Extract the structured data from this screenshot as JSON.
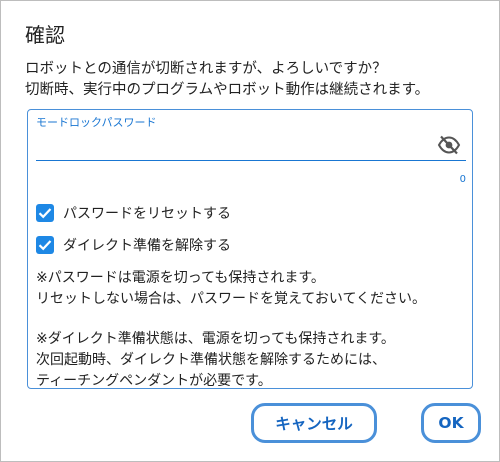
{
  "dialog": {
    "title": "確認",
    "message_line1": "ロボットとの通信が切断されますが、よろしいですか？",
    "message_line2": "切断時、実行中のプログラムやロボット動作は継続されます。"
  },
  "password_field": {
    "label": "モードロックパスワード",
    "value": "",
    "counter": "0",
    "toggle_icon": "eye-off-icon"
  },
  "checkboxes": [
    {
      "label": "パスワードをリセットする",
      "checked": true
    },
    {
      "label": "ダイレクト準備を解除する",
      "checked": true
    }
  ],
  "notes": {
    "line1": "※パスワードは電源を切っても保持されます。",
    "line2": "リセットしない場合は、パスワードを覚えておいてください。",
    "line3": "※ダイレクト準備状態は、電源を切っても保持されます。",
    "line4": "次回起動時、ダイレクト準備状態を解除するためには、",
    "line5": "ティーチングペンダントが必要です。"
  },
  "buttons": {
    "cancel": "キャンセル",
    "ok": "OK"
  },
  "colors": {
    "accent": "#1976d2",
    "panel_border": "#4a90d9",
    "checkbox": "#1e88e5"
  }
}
